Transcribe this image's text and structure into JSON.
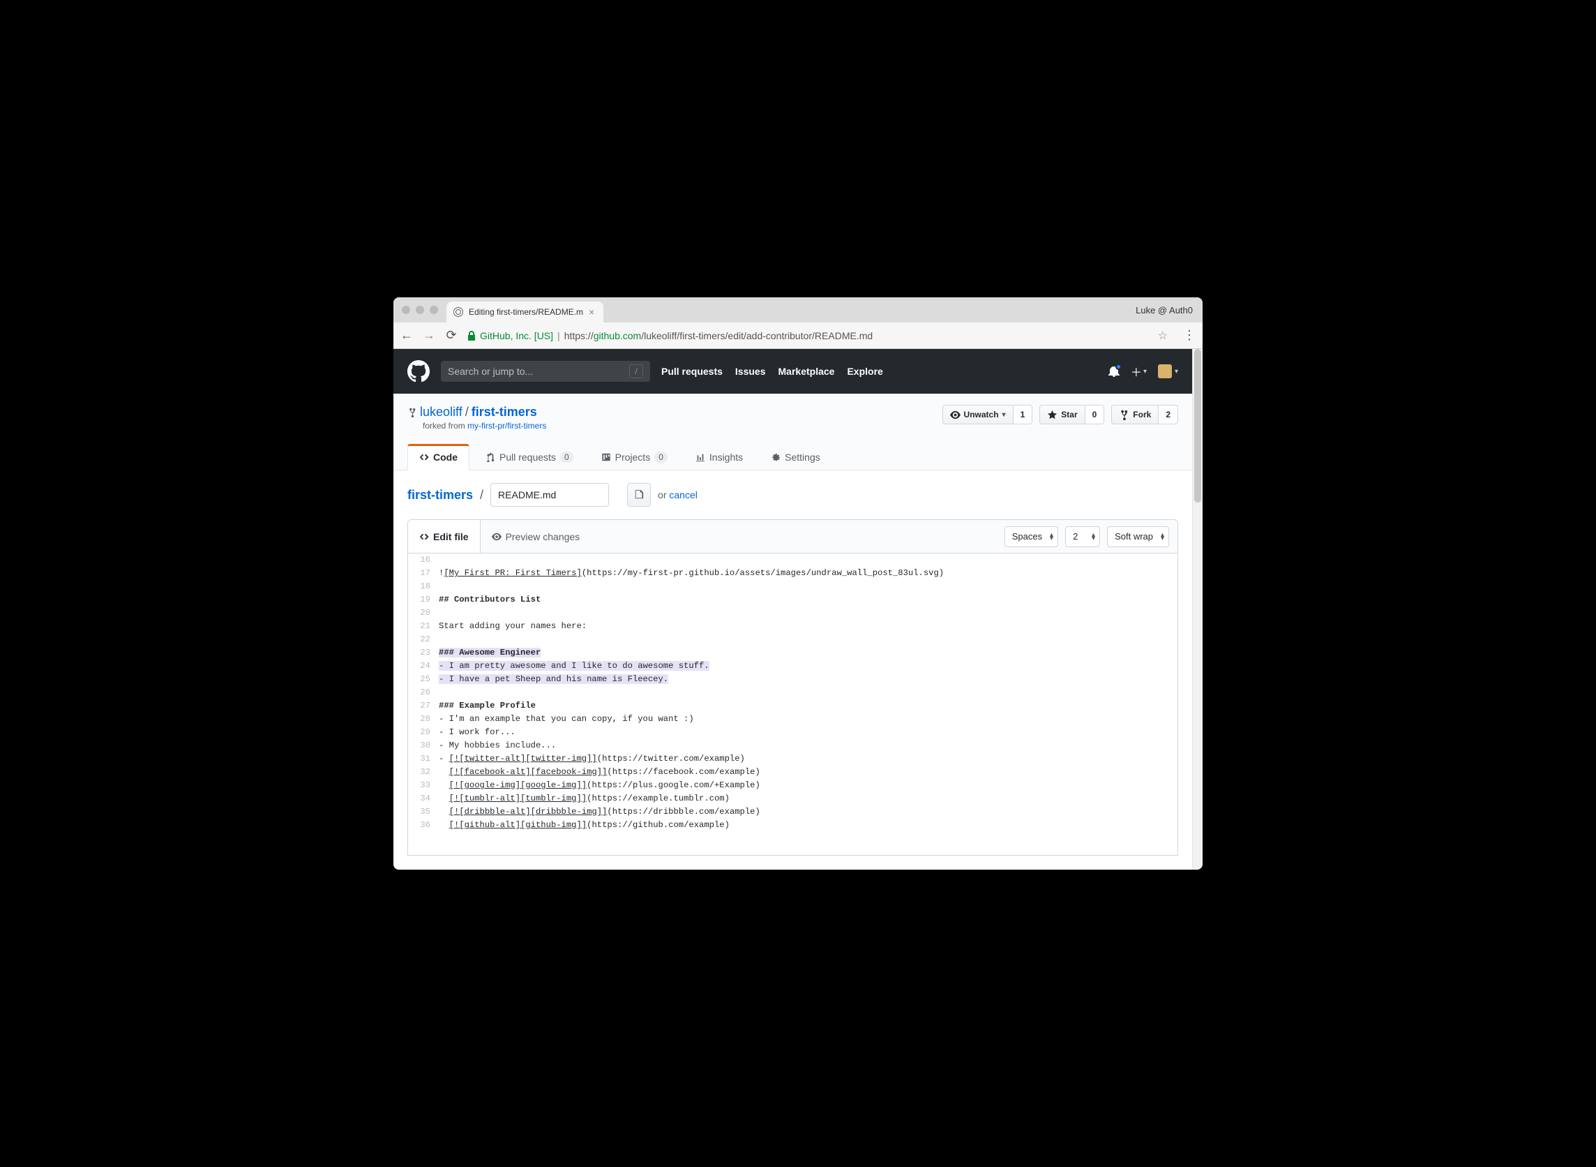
{
  "browser": {
    "tab_title": "Editing first-timers/README.m",
    "profile": "Luke @ Auth0",
    "url_org": "GitHub, Inc. [US]",
    "url_prefix": "https://",
    "url_host": "github.com",
    "url_path": "/lukeoliff/first-timers/edit/add-contributor/README.md"
  },
  "gh_header": {
    "search_placeholder": "Search or jump to...",
    "nav": {
      "pull_requests": "Pull requests",
      "issues": "Issues",
      "marketplace": "Marketplace",
      "explore": "Explore"
    }
  },
  "repo": {
    "owner": "lukeoliff",
    "name": "first-timers",
    "forked_prefix": "forked from ",
    "forked_from": "my-first-pr/first-timers",
    "actions": {
      "unwatch": "Unwatch",
      "unwatch_count": "1",
      "star": "Star",
      "star_count": "0",
      "fork": "Fork",
      "fork_count": "2"
    },
    "tabs": {
      "code": "Code",
      "pull_requests": "Pull requests",
      "pr_count": "0",
      "projects": "Projects",
      "proj_count": "0",
      "insights": "Insights",
      "settings": "Settings"
    }
  },
  "crumb": {
    "root": "first-timers",
    "filename": "README.md",
    "or": "or ",
    "cancel": "cancel"
  },
  "editor": {
    "tab_edit": "Edit file",
    "tab_preview": "Preview changes",
    "indent_mode": "Spaces",
    "indent_size": "2",
    "wrap_mode": "Soft wrap"
  },
  "code_lines": [
    {
      "n": "16",
      "html": ""
    },
    {
      "n": "17",
      "html": "!<span class='u'>[My First PR: First Timers]</span>(https://my-first-pr.github.io/assets/images/undraw_wall_post_83ul.svg)"
    },
    {
      "n": "18",
      "html": ""
    },
    {
      "n": "19",
      "html": "## Contributors List",
      "bold": true
    },
    {
      "n": "20",
      "html": ""
    },
    {
      "n": "21",
      "html": "Start adding your names here:"
    },
    {
      "n": "22",
      "html": ""
    },
    {
      "n": "23",
      "html": "<span class='hl'>### Awesome Engineer</span>",
      "bold": true
    },
    {
      "n": "24",
      "html": "<span class='hl'>- I am pretty awesome and I like to do awesome stuff.</span>"
    },
    {
      "n": "25",
      "html": "<span class='hl'>- I have a pet Sheep and his name is Fleecey.</span>"
    },
    {
      "n": "26",
      "html": ""
    },
    {
      "n": "27",
      "html": "### Example Profile",
      "bold": true
    },
    {
      "n": "28",
      "html": "- I'm an example that you can copy, if you want :)"
    },
    {
      "n": "29",
      "html": "- I work for..."
    },
    {
      "n": "30",
      "html": "- My hobbies include..."
    },
    {
      "n": "31",
      "html": "- <span class='u'>[![twitter-alt][twitter-img]]</span>(https://twitter.com/example)"
    },
    {
      "n": "32",
      "html": "  <span class='u'>[![facebook-alt][facebook-img]]</span>(https://facebook.com/example)"
    },
    {
      "n": "33",
      "html": "  <span class='u'>[![google-img][google-img]]</span>(https://plus.google.com/+Example)"
    },
    {
      "n": "34",
      "html": "  <span class='u'>[![tumblr-alt][tumblr-img]]</span>(https://example.tumblr.com)"
    },
    {
      "n": "35",
      "html": "  <span class='u'>[![dribbble-alt][dribbble-img]]</span>(https://dribbble.com/example)"
    },
    {
      "n": "36",
      "html": "  <span class='u'>[![github-alt][github-img]]</span>(https://github.com/example)"
    }
  ]
}
